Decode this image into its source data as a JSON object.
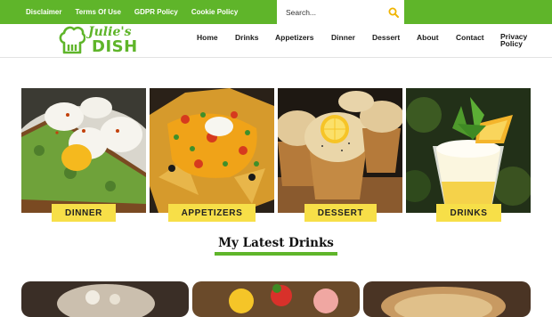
{
  "topbar": {
    "links": [
      "Disclaimer",
      "Terms Of Use",
      "GDPR Policy",
      "Cookie Policy"
    ],
    "search_placeholder": "Search...",
    "search_icon": "search-icon"
  },
  "logo": {
    "line1": "Julie's",
    "line2": "DISH",
    "icon": "chef-hat-icon"
  },
  "nav": {
    "home": "Home",
    "drinks": "Drinks",
    "appetizers": "Appetizers",
    "dinner": "Dinner",
    "dessert": "Dessert",
    "about": "About",
    "contact": "Contact",
    "privacy": "Privacy Policy"
  },
  "categories": [
    "DINNER",
    "APPETIZERS",
    "DESSERT",
    "DRINKS"
  ],
  "section": {
    "title": "My Latest Drinks"
  },
  "colors": {
    "brand_green": "#5fb52a",
    "label_yellow": "#f7df48"
  }
}
